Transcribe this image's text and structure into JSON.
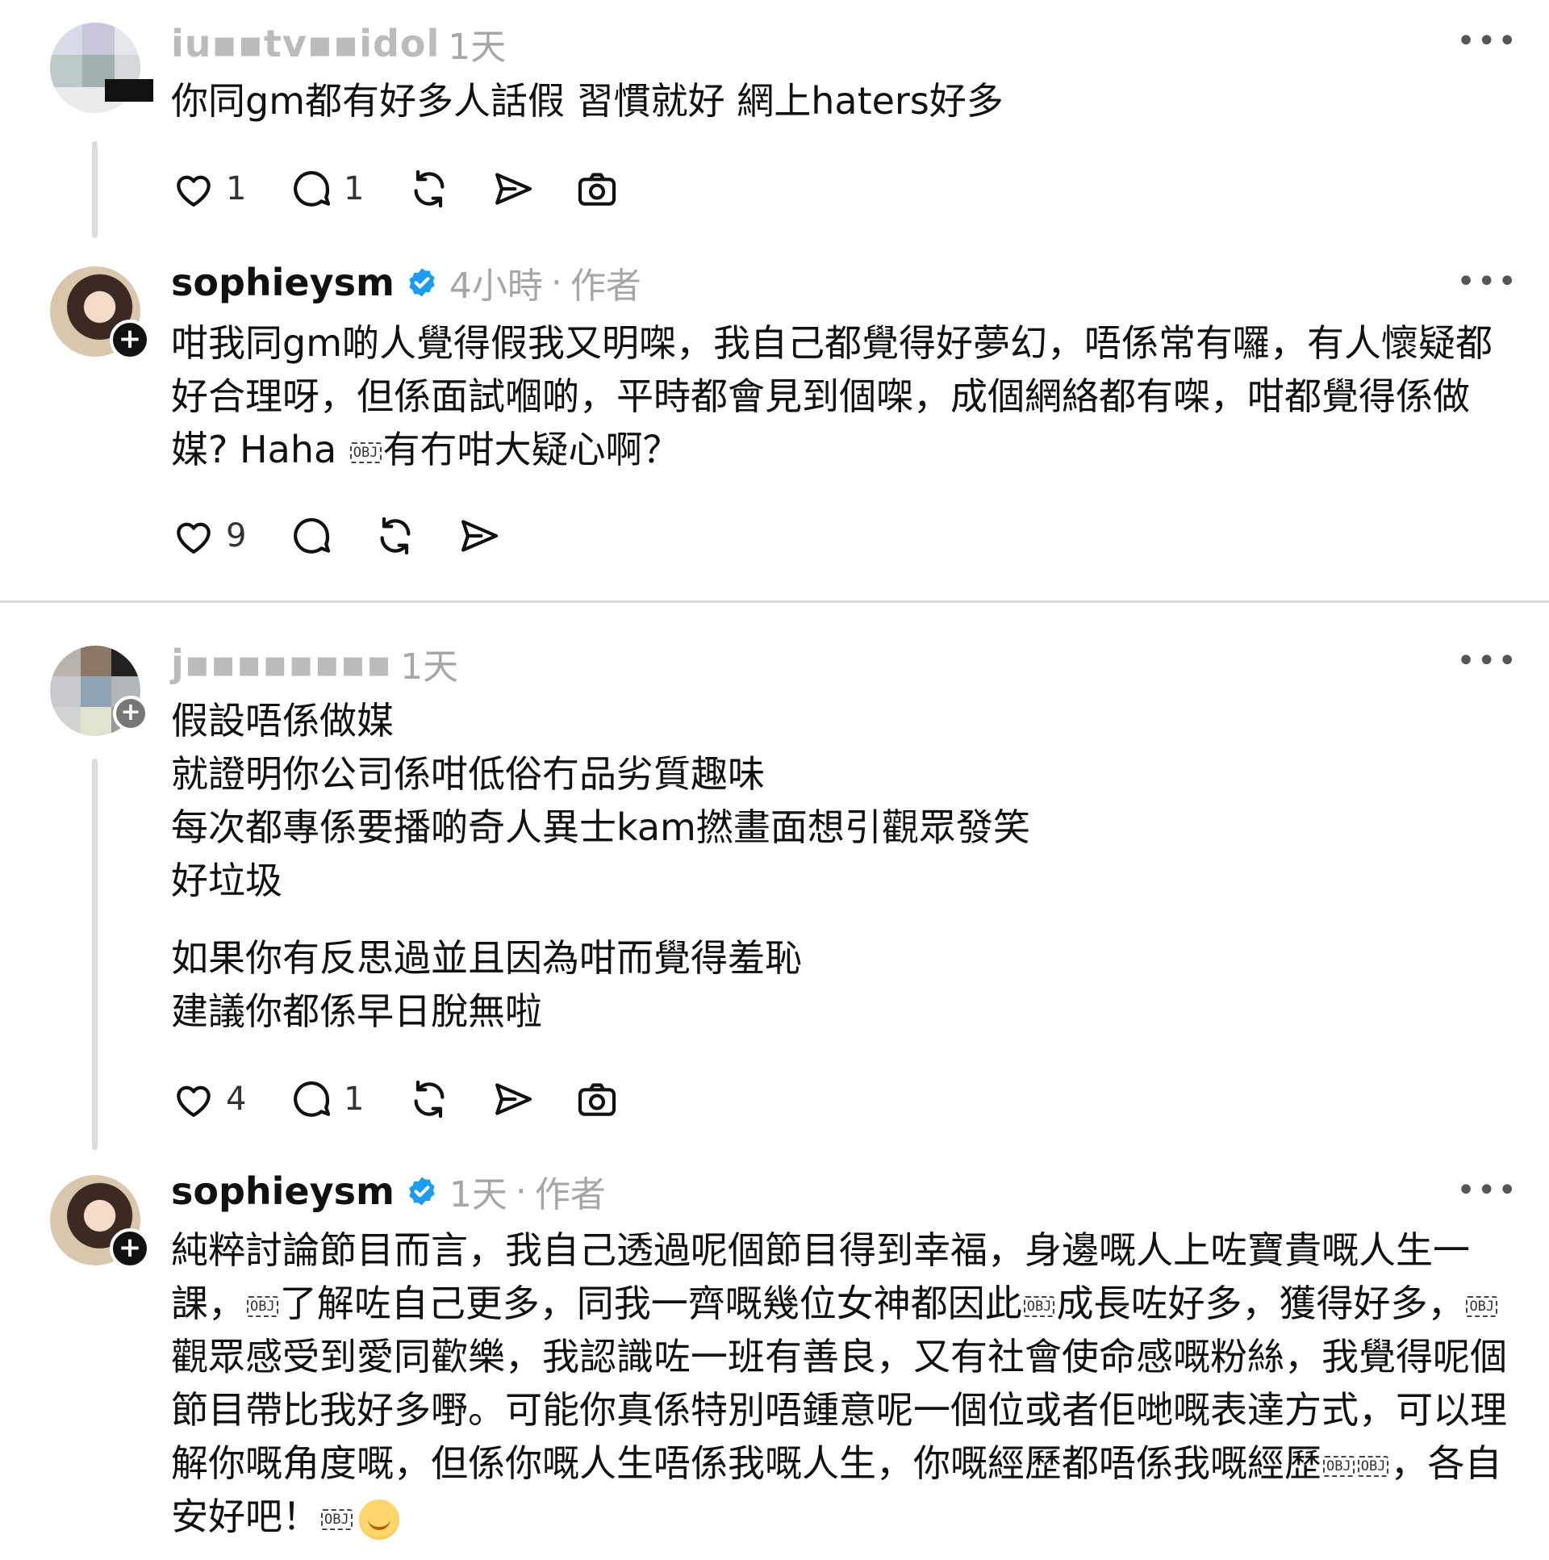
{
  "icons": {
    "like": "heart-icon",
    "reply": "comment-icon",
    "repost": "repost-icon",
    "share": "send-icon",
    "photo": "camera-icon",
    "verified": "verified-badge-icon",
    "more": "more-icon",
    "follow": "plus-icon"
  },
  "colors": {
    "verified": "#1d9bf0",
    "meta": "#a6a6a6",
    "thread_line": "#dcdcdc"
  },
  "posts": [
    {
      "username": "iu▪▪tv▪▪idol",
      "time": "1天",
      "author_tag": "",
      "lines": [
        "你同gm都有好多人話假 習慣就好 網上haters好多"
      ],
      "likes": "1",
      "replies": "1"
    },
    {
      "username": "sophieysm",
      "time": "4小時",
      "separator": "·",
      "author_tag": "作者",
      "lines": [
        "咁我同gm啲人覺得假我又明㗎，我自己都覺得好夢幻，唔係常有囉，有人懷疑都",
        "好合理呀，但係面試嗰啲，平時都會見到個㗎，成個網絡都有㗎，咁都覺得係做",
        "媒? Haha",
        "有冇咁大疑心啊？"
      ],
      "likes": "9",
      "replies": ""
    },
    {
      "username": "j▪▪▪▪▪▪▪▪",
      "time": "1天",
      "author_tag": "",
      "lines": [
        "假設唔係做媒",
        "就證明你公司係咁低俗冇品劣質趣味",
        "每次都專係要播啲奇人異士kam撚畫面想引觀眾發笑",
        "好垃圾",
        "如果你有反思過並且因為咁而覺得羞恥",
        "建議你都係早日脫無啦"
      ],
      "likes": "4",
      "replies": "1"
    },
    {
      "username": "sophieysm",
      "time": "1天",
      "separator": "·",
      "author_tag": "作者",
      "lines": [
        "純粹討論節目而言，我自己透過呢個節目得到幸福，身邊嘅人上咗寶貴嘅人生一",
        "課，",
        "了解咗自己更多，同我一齊嘅幾位女神都因此",
        "成長咗好多，獲得好多，",
        "觀眾感受到愛同歡樂，我認識咗一班有善良，又有社會使命感嘅粉絲，我覺得呢個",
        "節目帶比我好多嘢。可能你真係特別唔鍾意呢一個位或者佢哋嘅表達方式，可以理",
        "解你嘅角度嘅，但係你嘅人生唔係我嘅人生，你嘅經歷都唔係我嘅經歷",
        "，各自",
        "安好吧！"
      ],
      "obj_marker": "OBJ"
    }
  ]
}
